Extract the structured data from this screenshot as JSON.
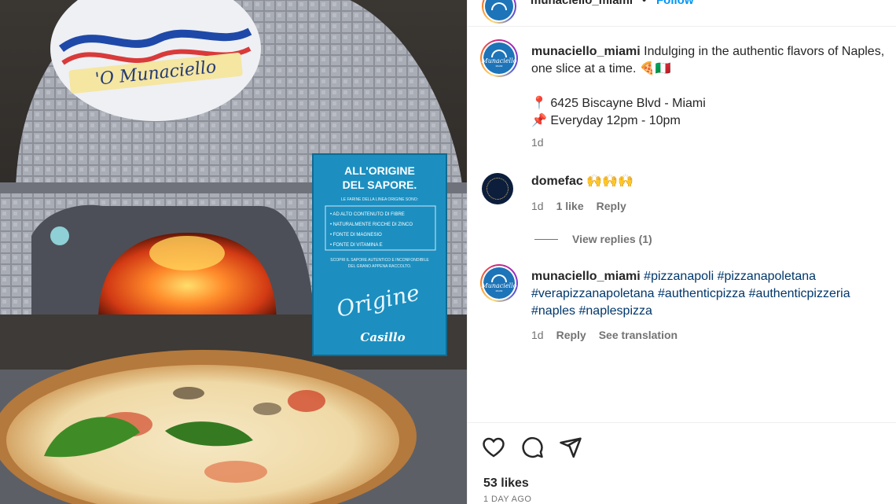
{
  "photo": {
    "alt_sign_title": "ALL'ORIGINE DEL SAPORE.",
    "sign_intro": "LE FARINE DELLA LINEA ORIGINE SONO:",
    "sign_bullets": [
      "AD ALTO CONTENUTO DI FIBRE",
      "NATURALMENTE RICCHE DI ZINCO",
      "FONTE DI MAGNESIO",
      "FONTE DI VITAMINA E"
    ],
    "sign_footer_1": "SCOPRI IL SAPORE AUTENTICO E INCONFONDIBILE",
    "sign_footer_2": "DEL GRANO APPENA RACCOLTO.",
    "sign_script": "Origine",
    "sign_brand": "Casillo",
    "oven_logo": "'O Munaciello"
  },
  "header": {
    "username": "munaciello_miami",
    "dot": "•",
    "follow_label": "Follow"
  },
  "avatar": {
    "logo_text": "Munaciello",
    "logo_sub": "MIAMI"
  },
  "caption": {
    "username": "munaciello_miami",
    "line1": "Indulging in the authentic flavors of Naples,",
    "line2": "one slice at a time. 🍕🇮🇹",
    "address_icon": "📍",
    "address": "6425 Biscayne Blvd - Miami",
    "hours_icon": "📌",
    "hours": "Everyday 12pm - 10pm",
    "time": "1d"
  },
  "comment1": {
    "username": "domefac",
    "text": "🙌🙌🙌",
    "time": "1d",
    "likes": "1 like",
    "reply": "Reply",
    "view_replies": "View replies (1)"
  },
  "comment2": {
    "username": "munaciello_miami",
    "tags_line1": [
      "#pizzanapoli",
      "#pizzanapoletana"
    ],
    "tags_line2": [
      "#verapizzanapoletana",
      "#authenticpizza",
      "#authenticpizzeria"
    ],
    "tags_line3": [
      "#naples",
      "#naplespizza"
    ],
    "time": "1d",
    "reply": "Reply",
    "see_translation": "See translation"
  },
  "actions": {
    "icons": [
      "heart-icon",
      "comment-icon",
      "share-icon"
    ],
    "likes": "53 likes",
    "date": "1 DAY AGO"
  }
}
